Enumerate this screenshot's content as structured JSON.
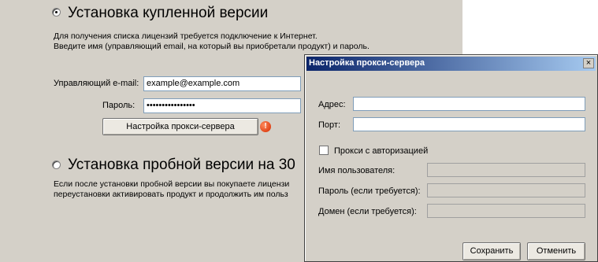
{
  "purchased": {
    "radio_label": "Установка купленной версии",
    "description_line1": "Для получения списка лицензий требуется подключение к Интернет.",
    "description_line2": "Введите имя (управляющий email, на который вы приобретали продукт) и пароль.",
    "email_label": "Управляющий e-mail:",
    "email_value": "example@example.com",
    "password_label": "Пароль:",
    "password_value": "••••••••••••••••",
    "proxy_button": "Настройка прокси-сервера",
    "error_icon_glyph": "!"
  },
  "trial": {
    "radio_label": "Установка  пробной версии на 30",
    "description_line1": "Если после установки пробной версии вы покупаете лицензи",
    "description_line2": "переустановки активировать продукт и продолжить им польз"
  },
  "proxy_dialog": {
    "title": "Настройка прокси-сервера",
    "close_glyph": "×",
    "address_label": "Адрес:",
    "address_value": "",
    "port_label": "Порт:",
    "port_value": "",
    "auth_checkbox_label": "Прокси с авторизацией",
    "username_label": "Имя пользователя:",
    "password_label": "Пароль (если требуется):",
    "domain_label": "Домен (если требуется):",
    "save_button": "Сохранить",
    "cancel_button": "Отменить"
  }
}
